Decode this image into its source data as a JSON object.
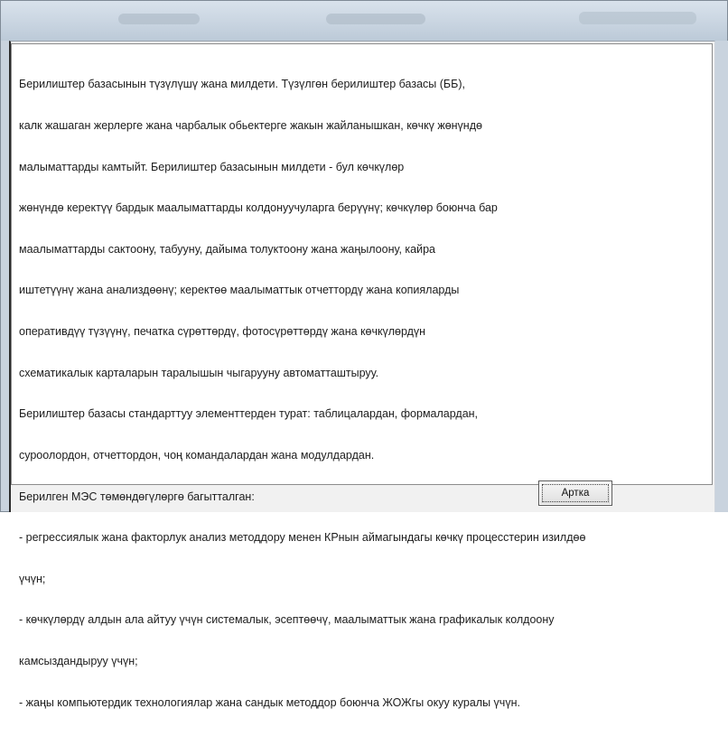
{
  "window": {
    "body_lines": [
      "Берилиштер базасынын түзүлүшү жана милдети. Түзүлгөн берилиштер базасы (ББ),",
      "калк жашаган жерлерге жана чарбалык обьектерге жакын жайланышкан, көчкү жөнүндө",
      "малыматтарды камтыйт. Берилиштер базасынын милдети - бул көчкүлөр",
      "жөнүндө керектүү бардык маалыматтарды колдонуучуларга берүүнү; көчкүлөр боюнча бар",
      "маалыматтарды сактоону, табууну, дайыма толуктоону жана жаңылоону, кайра",
      "иштетүүнү жана анализдөөнү; керектөө маалыматтык отчеттордү жана копияларды",
      "оперативдүү түзүүнү, печатка сүрөттөрдү, фотосүрөттөрдү жана көчкүлөрдүн",
      "схематикалык карталарын таралышын чыгарууну автоматташтыруу.",
      "Берилиштер  базасы стандарттуу элементтерден турат: таблицалардан, формалардан,",
      "суроолордон, отчеттордон, чоң командалардан жана модулдардан.",
      "Берилген МЭС төмөндөгүлөргө багытталган:",
      "- регрессиялык жана факторлук анализ методдору менен КРнын аймагындагы көчкү процесстерин изилдөө",
      "үчүн;",
      "- көчкүлөрдү алдын ала айтуу үчүн системалык, эсептөөчү, маалыматтык жана графикалык колдоону",
      "камсыздандыруу үчүн;",
      "- жаңы компьютердик технологиялар жана сандык методдор боюнча ЖОЖгы окуу куралы үчүн."
    ],
    "back_button_label": "Артка"
  }
}
